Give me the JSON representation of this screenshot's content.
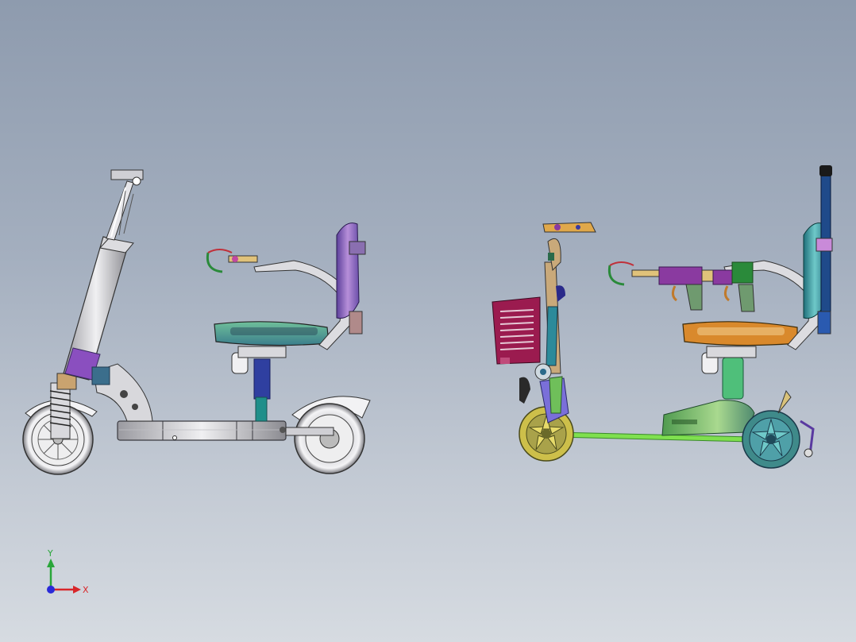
{
  "viewport": {
    "background_top": "#8e9bae",
    "background_bottom": "#d6dbe1"
  },
  "models": [
    {
      "name": "scooter-model-shaded-grey",
      "colors": [
        "#e8e8ea",
        "#8a4fbf",
        "#3b6e8c",
        "#1f8f8a"
      ]
    },
    {
      "name": "scooter-model-colored-parts",
      "colors": [
        "#9b1b4f",
        "#6fbf5a",
        "#d9a94a",
        "#2c8a9a",
        "#c07a2c"
      ]
    }
  ],
  "triad": {
    "x_label": "X",
    "y_label": "Y",
    "x_color": "#d8262a",
    "y_color": "#2aa63a",
    "z_color": "#2a2ad8"
  }
}
